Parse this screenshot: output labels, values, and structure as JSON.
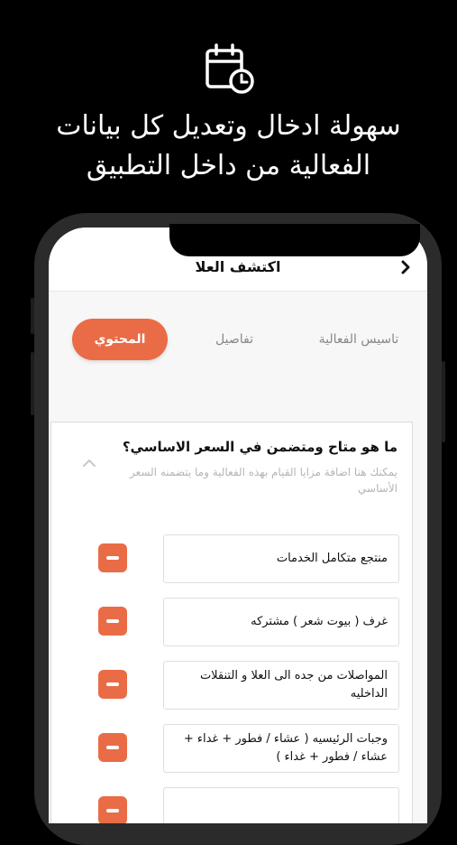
{
  "hero": {
    "line1": "سهولة ادخال وتعديل كل بيانات",
    "line2": "الفعالية من داخل التطبيق",
    "icon": "calendar-clock-icon"
  },
  "appbar": {
    "title": "اكتشف العلا",
    "back_icon": "chevron-right-icon"
  },
  "tabs": [
    {
      "label": "تاسيس الفعالية",
      "active": false
    },
    {
      "label": "تفاصيل",
      "active": false
    },
    {
      "label": "المحتوي",
      "active": true
    }
  ],
  "question": {
    "title": "ما هو متاح ومتضمن في السعر الاساسي؟",
    "description": "يمكنك هنا اضافة مزايا القيام بهذه الفعالية وما يتضمنه السعر الأساسي"
  },
  "items": [
    {
      "text": "منتجع متكامل الخدمات"
    },
    {
      "text": "غرف ( بيوت شعر ) مشتركه"
    },
    {
      "text": "المواصلات من جده الى العلا و التنقلات الداخليه"
    },
    {
      "text": "وجبات الرئيسيه ( عشاء / فطور + غداء + عشاء / فطور + غداء )"
    }
  ],
  "colors": {
    "accent": "#e96c47",
    "background": "#000000"
  }
}
